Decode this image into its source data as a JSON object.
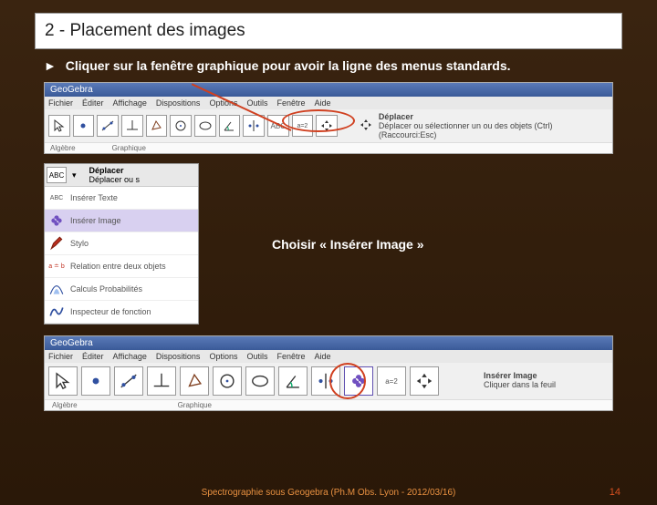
{
  "title": "2 - Placement des images",
  "instruction": {
    "arrow": "►",
    "text": "Cliquer sur la fenêtre graphique pour avoir la ligne des menus standards."
  },
  "shot1": {
    "app": "GeoGebra",
    "menus": [
      "Fichier",
      "Éditer",
      "Affichage",
      "Dispositions",
      "Options",
      "Outils",
      "Fenêtre",
      "Aide"
    ],
    "abc": "ABC",
    "avar": "a=2",
    "desc_title": "Déplacer",
    "desc_sub": "Déplacer ou sélectionner un ou des objets (Ctrl) (Raccourci:Esc)",
    "sub_algebre": "Algèbre",
    "sub_graphique": "Graphique"
  },
  "dropdown": {
    "top_abc": "ABC",
    "top_arrow": "▾",
    "top_title": "Déplacer",
    "top_sub": "Déplacer ou s",
    "items": [
      {
        "icon": "text",
        "label": "Insérer Texte"
      },
      {
        "icon": "image",
        "label": "Insérer Image",
        "highlighted": true
      },
      {
        "icon": "pen",
        "label": "Stylo"
      },
      {
        "icon": "rel",
        "label": "Relation entre deux objets",
        "pre": "a ≐ b"
      },
      {
        "icon": "calc",
        "label": "Calculs Probabilités"
      },
      {
        "icon": "insp",
        "label": "Inspecteur de fonction"
      }
    ]
  },
  "choisir_text": "Choisir « Insérer Image »",
  "shot3": {
    "app": "GeoGebra",
    "menus": [
      "Fichier",
      "Éditer",
      "Affichage",
      "Dispositions",
      "Options",
      "Outils",
      "Fenêtre",
      "Aide"
    ],
    "avar": "a=2",
    "inserer_title": "Insérer Image",
    "inserer_sub": "Cliquer dans la feuil",
    "sub_algebre": "Algèbre",
    "sub_graphique": "Graphique"
  },
  "footer": "Spectrographie sous Geogebra (Ph.M Obs. Lyon - 2012/03/16)",
  "page": "14"
}
